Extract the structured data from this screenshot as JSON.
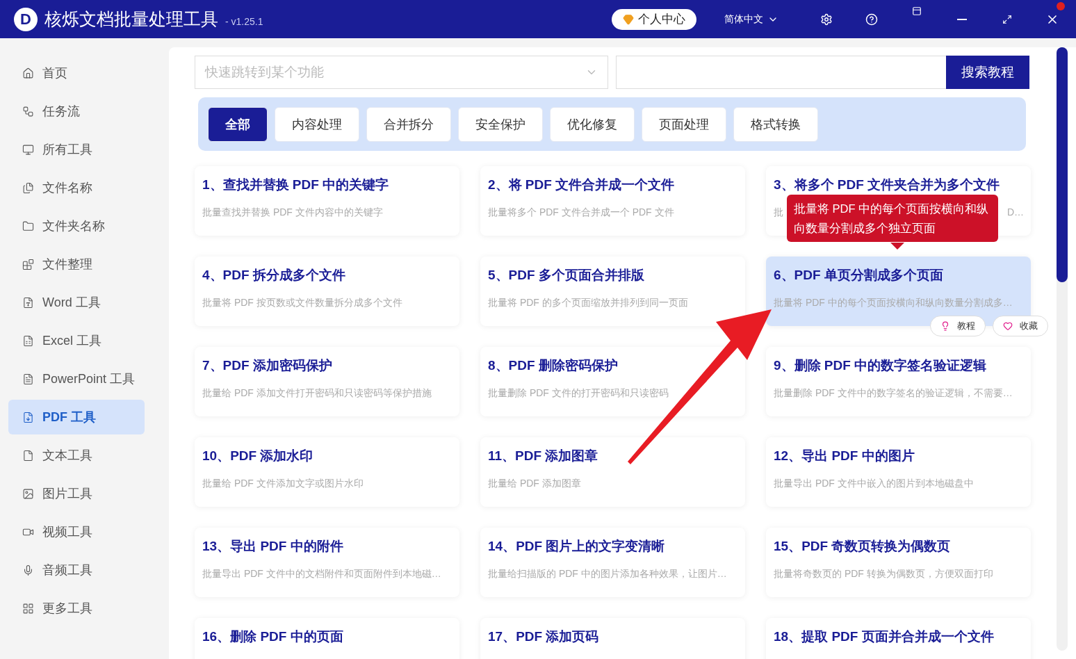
{
  "window": {
    "logo": "D",
    "title": "核烁文档批量处理工具",
    "version": "- v1.25.1",
    "user_button": "个人中心",
    "language": "简体中文"
  },
  "sidebar": {
    "items": [
      {
        "label": "首页",
        "selected": false
      },
      {
        "label": "任务流",
        "selected": false
      },
      {
        "label": "所有工具",
        "selected": false
      },
      {
        "label": "文件名称",
        "selected": false
      },
      {
        "label": "文件夹名称",
        "selected": false
      },
      {
        "label": "文件整理",
        "selected": false
      },
      {
        "label": "Word 工具",
        "selected": false
      },
      {
        "label": "Excel 工具",
        "selected": false
      },
      {
        "label": "PowerPoint 工具",
        "selected": false
      },
      {
        "label": "PDF 工具",
        "selected": true
      },
      {
        "label": "文本工具",
        "selected": false
      },
      {
        "label": "图片工具",
        "selected": false
      },
      {
        "label": "视频工具",
        "selected": false
      },
      {
        "label": "音频工具",
        "selected": false
      },
      {
        "label": "更多工具",
        "selected": false
      }
    ]
  },
  "search": {
    "jump_placeholder": "快速跳转到某个功能",
    "button": "搜索教程"
  },
  "tabs": [
    {
      "label": "全部",
      "selected": true
    },
    {
      "label": "内容处理",
      "selected": false
    },
    {
      "label": "合并拆分",
      "selected": false
    },
    {
      "label": "安全保护",
      "selected": false
    },
    {
      "label": "优化修复",
      "selected": false
    },
    {
      "label": "页面处理",
      "selected": false
    },
    {
      "label": "格式转换",
      "selected": false
    }
  ],
  "cards": [
    {
      "title": "1、查找并替换 PDF 中的关键字",
      "description": "批量查找并替换 PDF 文件内容中的关键字",
      "hovered": false
    },
    {
      "title": "2、将 PDF 文件合并成一个文件",
      "description": "批量将多个 PDF 文件合并成一个 PDF 文件",
      "hovered": false
    },
    {
      "title": "3、将多个 PDF 文件夹合并为多个文件",
      "description": "批",
      "description_end": "D…",
      "hovered": false
    },
    {
      "title": "4、PDF 拆分成多个文件",
      "description": "批量将 PDF 按页数或文件数量拆分成多个文件",
      "hovered": false
    },
    {
      "title": "5、PDF 多个页面合并排版",
      "description": "批量将 PDF 的多个页面缩放并排列到同一页面",
      "hovered": false
    },
    {
      "title": "6、PDF 单页分割成多个页面",
      "description": "批量将 PDF 中的每个页面按横向和纵向数量分割成多…",
      "hovered": true,
      "tooltip": "批量将 PDF 中的每个页面按横向和纵向数量分割成多个独立页面",
      "actions": [
        "教程",
        "收藏"
      ]
    },
    {
      "title": "7、PDF 添加密码保护",
      "description": "批量给 PDF 添加文件打开密码和只读密码等保护措施",
      "hovered": false
    },
    {
      "title": "8、PDF 删除密码保护",
      "description": "批量删除 PDF 文件的打开密码和只读密码",
      "hovered": false
    },
    {
      "title": "9、删除 PDF 中的数字签名验证逻辑",
      "description": "批量删除 PDF 文件中的数字签名的验证逻辑，不需要…",
      "hovered": false
    },
    {
      "title": "10、PDF 添加水印",
      "description": "批量给 PDF 文件添加文字或图片水印",
      "hovered": false
    },
    {
      "title": "11、PDF 添加图章",
      "description": "批量给 PDF 添加图章",
      "hovered": false
    },
    {
      "title": "12、导出 PDF 中的图片",
      "description": "批量导出 PDF 文件中嵌入的图片到本地磁盘中",
      "hovered": false
    },
    {
      "title": "13、导出 PDF 中的附件",
      "description": "批量导出 PDF 文件中的文档附件和页面附件到本地磁…",
      "hovered": false
    },
    {
      "title": "14、PDF 图片上的文字变清晰",
      "description": "批量给扫描版的 PDF 中的图片添加各种效果，让图片…",
      "hovered": false
    },
    {
      "title": "15、PDF 奇数页转换为偶数页",
      "description": "批量将奇数页的 PDF 转换为偶数页，方便双面打印",
      "hovered": false
    },
    {
      "title": "16、删除 PDF 中的页面",
      "hovered": false
    },
    {
      "title": "17、PDF 添加页码",
      "hovered": false
    },
    {
      "title": "18、提取 PDF 页面并合并成一个文件",
      "hovered": false
    }
  ]
}
